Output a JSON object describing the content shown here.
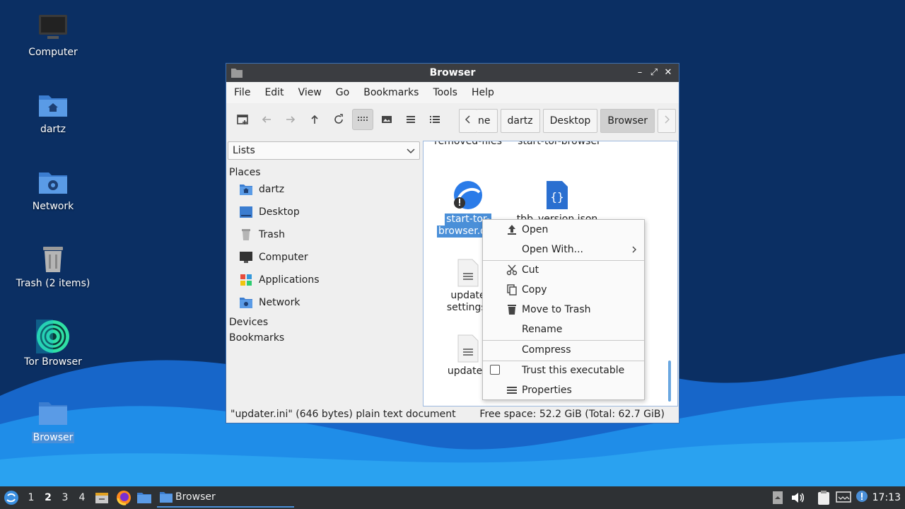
{
  "desktop": {
    "icons": [
      {
        "label": "Computer"
      },
      {
        "label": "dartz"
      },
      {
        "label": "Network"
      },
      {
        "label": "Trash (2 items)"
      },
      {
        "label": "Tor Browser"
      },
      {
        "label": "Browser"
      }
    ]
  },
  "window": {
    "title": "Browser",
    "menu": [
      "File",
      "Edit",
      "View",
      "Go",
      "Bookmarks",
      "Tools",
      "Help"
    ],
    "breadcrumbs": [
      "ne",
      "dartz",
      "Desktop",
      "Browser"
    ],
    "sidebar": {
      "mode": "Lists",
      "places_header": "Places",
      "places": [
        "dartz",
        "Desktop",
        "Trash",
        "Computer",
        "Applications",
        "Network"
      ],
      "devices_header": "Devices",
      "bookmarks_header": "Bookmarks"
    },
    "files": {
      "top_left_partial": "removed-files",
      "top_right_partial": "start-tor-browser",
      "selected_line1": "start-tor-",
      "selected_line2": "browser.des",
      "json_file": "tbb_version.json",
      "update_line1": "update",
      "update_line2": "settings.",
      "updater": "updater."
    },
    "status": {
      "left": "\"updater.ini\" (646 bytes) plain text document",
      "right": "Free space: 52.2 GiB (Total: 62.7 GiB)"
    }
  },
  "context_menu": {
    "open": "Open",
    "open_with": "Open With...",
    "cut": "Cut",
    "copy": "Copy",
    "move_to_trash": "Move to Trash",
    "rename": "Rename",
    "compress": "Compress",
    "trust": "Trust this executable",
    "properties": "Properties"
  },
  "taskbar": {
    "workspaces": [
      "1",
      "2",
      "3",
      "4"
    ],
    "current_workspace": "2",
    "task": "Browser",
    "clock": "17:13"
  }
}
